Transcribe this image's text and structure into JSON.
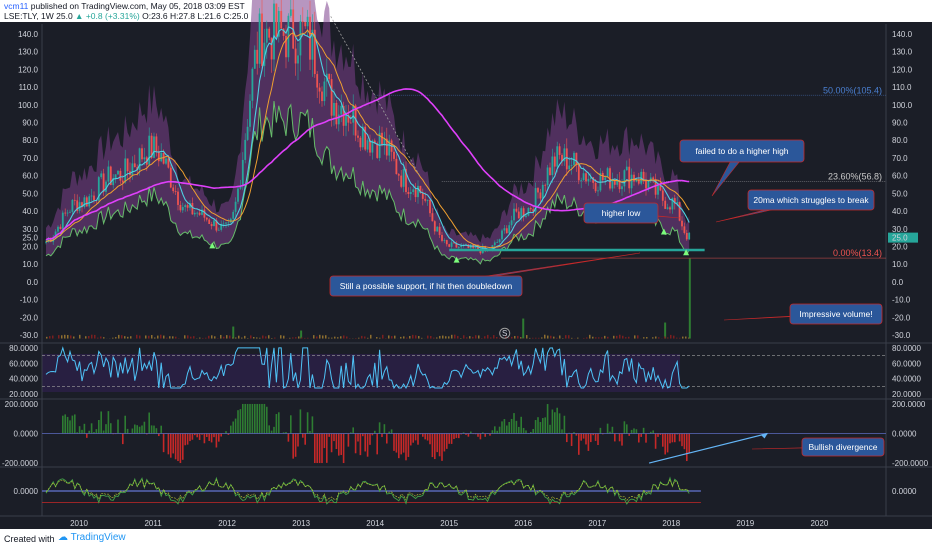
{
  "header": {
    "user": "vcm11",
    "published": "published on TradingView.com, May 05, 2018 03:09 EST",
    "symbol_line": "LSE:TLY, 1W 25.0",
    "change": "+0.8 (+3.31%)",
    "ohlc": "O:23.6 H:27.8 L:21.6 C:25.0"
  },
  "footer": {
    "created_with": "Created with",
    "brand": "TradingView"
  },
  "colors": {
    "background": "#1b1e27",
    "candle_up": "#26a69a",
    "candle_down": "#ef5350",
    "bollinger_fill": "#7b3f8c",
    "ma_long": "#e040fb",
    "ma_short": "#4dd0e1",
    "ma_mid": "#f0a030",
    "rsi_line": "#4fc3f7",
    "macd_up": "#2e7d32",
    "macd_down": "#c62828",
    "annotation_box": "#2b579a",
    "support_line": "#26a69a"
  },
  "chart_data": [
    {
      "type": "line",
      "panel": "price",
      "x": [
        "2009-07",
        "2010-01",
        "2010-07",
        "2011-01",
        "2011-07",
        "2012-01",
        "2012-07",
        "2013-01",
        "2013-07",
        "2014-01",
        "2014-07",
        "2015-01",
        "2015-07",
        "2016-01",
        "2016-07",
        "2017-01",
        "2017-07",
        "2018-01",
        "2018-04"
      ],
      "close_approx": [
        22,
        45,
        60,
        75,
        40,
        30,
        140,
        140,
        100,
        80,
        55,
        20,
        18,
        40,
        70,
        58,
        60,
        45,
        25
      ],
      "x_ticks": [
        "2010",
        "2011",
        "2012",
        "2013",
        "2014",
        "2015",
        "2016",
        "2017",
        "2018",
        "2019",
        "2020"
      ],
      "y_ticks_left": [
        "140.0",
        "130.0",
        "120.0",
        "110.0",
        "100.0",
        "90.0",
        "80.0",
        "70.0",
        "60.0",
        "50.0",
        "40.0",
        "30.0",
        "25.0",
        "20.0",
        "10.0",
        "0.0",
        "-10.0",
        "-20.0",
        "-30.0"
      ],
      "y_ticks_right": [
        "140.0",
        "130.0",
        "120.0",
        "110.0",
        "100.0",
        "90.0",
        "80.0",
        "70.0",
        "60.0",
        "50.0",
        "40.0",
        "30.0",
        "25.0",
        "20.0",
        "10.0",
        "0.0",
        "-10.0",
        "-20.0",
        "-30.0"
      ],
      "fib_levels": [
        {
          "label": "50.00%(105.4)",
          "value": 105.4,
          "color": "#4a7fd1"
        },
        {
          "label": "23.60%(56.8)",
          "value": 56.8,
          "color": "#c9c9c9"
        },
        {
          "label": "0.00%(13.4)",
          "value": 13.4,
          "color": "#ef5350"
        }
      ],
      "support_level": 18
    },
    {
      "type": "bar",
      "panel": "volume",
      "spikes": [
        {
          "date": "2012-02",
          "value": 0.15
        },
        {
          "date": "2013-01",
          "value": 0.1
        },
        {
          "date": "2016-01",
          "value": 0.25
        },
        {
          "date": "2017-12",
          "value": 0.2
        },
        {
          "date": "2018-04",
          "value": 1.0
        }
      ]
    },
    {
      "type": "line",
      "panel": "rsi",
      "y_ticks": [
        "80.0000",
        "60.0000",
        "40.0000",
        "20.0000"
      ],
      "y_ticks_right": [
        "80.0000",
        "60.0000",
        "40.0000",
        "20.0000"
      ],
      "bands": [
        70,
        30
      ]
    },
    {
      "type": "bar",
      "panel": "macd_histogram",
      "y_ticks": [
        "200.0000",
        "0.0000",
        "-200.0000"
      ],
      "y_ticks_right": [
        "200.0000",
        "0.0000",
        "-200.0000"
      ]
    },
    {
      "type": "line",
      "panel": "oscillator",
      "y_ticks": [
        "0.0000"
      ],
      "y_ticks_right": [
        "0.0000"
      ]
    }
  ],
  "annotations": [
    {
      "id": "failed-higher-high",
      "text": "failed to do a higher high"
    },
    {
      "id": "ma20",
      "text": "20ma which struggles to break"
    },
    {
      "id": "higher-low",
      "text": "higher low"
    },
    {
      "id": "support",
      "text": "Still a possible support, if hit then doubledown"
    },
    {
      "id": "volume",
      "text": "Impressive volume!"
    },
    {
      "id": "divergence",
      "text": "Bullish divergence"
    }
  ],
  "marker_s": "S"
}
